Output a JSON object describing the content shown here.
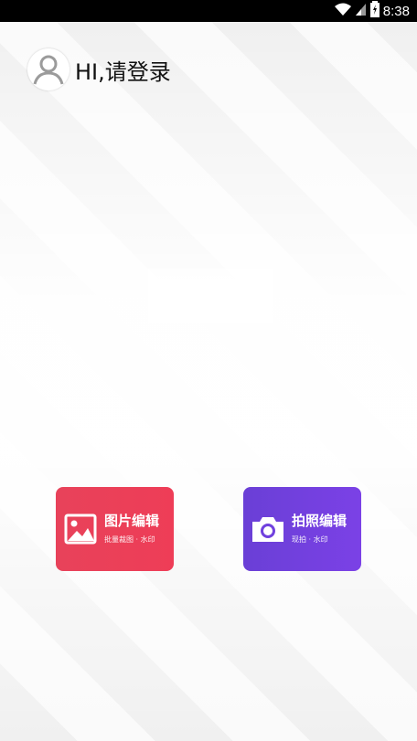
{
  "status_bar": {
    "time": "8:38"
  },
  "header": {
    "login_text": "HI,请登录"
  },
  "cards": [
    {
      "title": "图片编辑",
      "subtitle": "批量裁图 · 水印",
      "icon": "image-icon",
      "color": "#ea4059"
    },
    {
      "title": "拍照编辑",
      "subtitle": "现拍 · 水印",
      "icon": "camera-icon",
      "color": "#6f40dd"
    }
  ]
}
